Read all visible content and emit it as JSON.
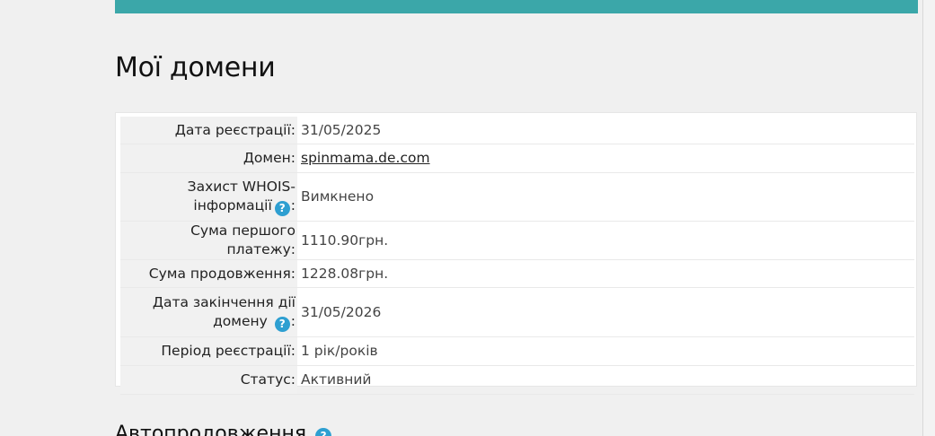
{
  "page": {
    "title": "Мої домени"
  },
  "details": {
    "registration_date_label": "Дата реєстрації:",
    "registration_date": "31/05/2025",
    "domain_label": "Домен:",
    "domain": "spinmama.de.com",
    "whois_label_line1": "Захист WHOIS-",
    "whois_label_line2": "інформації",
    "whois_value": "Вимкнено",
    "first_payment_label": "Сума першого платежу:",
    "first_payment": "1110.90грн.",
    "renewal_amount_label": "Сума продовження:",
    "renewal_amount": "1228.08грн.",
    "expiry_label_line1": "Дата закінчення дії",
    "expiry_label_line2": "домену",
    "expiry_date": "31/05/2026",
    "period_label": "Період реєстрації:",
    "period": "1 рік/років",
    "status_label": "Статус:",
    "status": "Активний",
    "colon": ":",
    "help_glyph": "?"
  },
  "autorenew": {
    "heading": "Автопродовження"
  },
  "theme": {
    "banner_color": "#3ba7a9",
    "help_icon_color": "#2e9fd1",
    "label_bg": "#f1f1f1"
  },
  "icons": {
    "help": "question-circle-icon"
  }
}
